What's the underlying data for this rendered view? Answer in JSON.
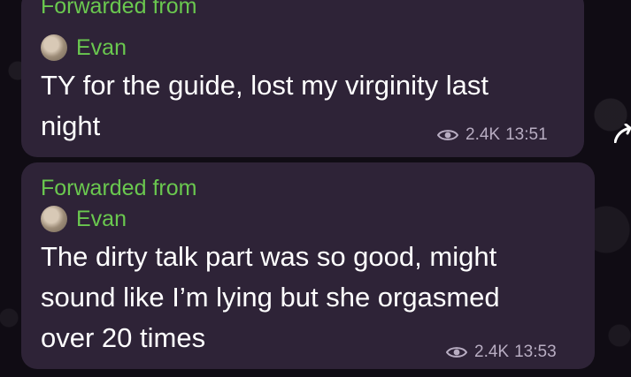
{
  "messages": [
    {
      "forward_label": "Forwarded from",
      "sender": "Evan",
      "text": "TY for the guide, lost my virginity last\nnight",
      "views": "2.4K",
      "time": "13:51"
    },
    {
      "forward_label": "Forwarded from",
      "sender": "Evan",
      "text": "The dirty talk part was so good, might\nsound like I’m lying but she orgasmed\nover 20 times",
      "views": "2.4K",
      "time": "13:53"
    }
  ],
  "colors": {
    "bubble": "#2e2337",
    "accent": "#6ac84f",
    "meta": "#b8adc2"
  },
  "icons": {
    "views": "eye-icon",
    "share": "share-icon",
    "avatar": "avatar"
  }
}
